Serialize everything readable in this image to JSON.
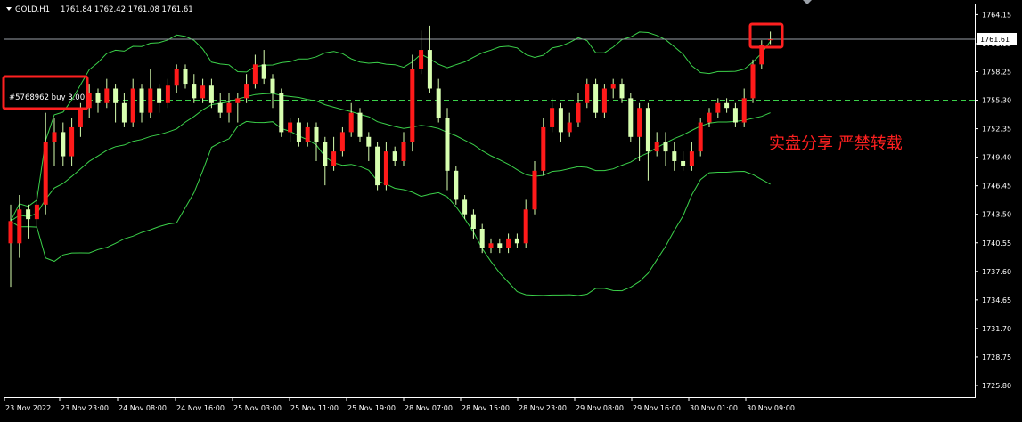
{
  "header": {
    "symbol": "GOLD,H1",
    "ohlc": "1761.84 1762.42 1761.08 1761.61"
  },
  "annotations": {
    "order_label": "#5768962 buy 3.00",
    "watermark": "实盘分享 严禁转载"
  },
  "colors": {
    "background": "#000000",
    "bull_candle": "#ff1a1a",
    "bear_candle": "#d8ffb0",
    "wick": "#d8ffb0",
    "bands": "#3bd14a",
    "order_line": "#3bd14a",
    "grid_axis": "#ffffff",
    "highlight_box": "#ff2020",
    "watermark": "#ff2020",
    "price_tag_bg": "#ffffff"
  },
  "chart_data": {
    "type": "candlestick",
    "timeframe": "H1",
    "y_axis": {
      "ylim": [
        1724.6,
        1765.2
      ],
      "ticks": [
        "1764.15",
        "1761.15",
        "1758.25",
        "1755.30",
        "1752.35",
        "1749.40",
        "1746.45",
        "1743.50",
        "1740.55",
        "1737.60",
        "1734.65",
        "1731.70",
        "1728.75",
        "1725.80"
      ],
      "current_price": "1761.61"
    },
    "x_axis": {
      "ticks": [
        "23 Nov 2022",
        "23 Nov 23:00",
        "24 Nov 08:00",
        "24 Nov 16:00",
        "25 Nov 03:00",
        "25 Nov 11:00",
        "25 Nov 19:00",
        "28 Nov 07:00",
        "28 Nov 15:00",
        "28 Nov 23:00",
        "29 Nov 08:00",
        "29 Nov 16:00",
        "30 Nov 01:00",
        "30 Nov 09:00"
      ]
    },
    "order_level": 1755.3,
    "candles": [
      [
        1740.5,
        1742.8,
        1736.0,
        1744.5
      ],
      [
        1740.5,
        1744.0,
        1739.0,
        1745.5
      ],
      [
        1744.0,
        1743.0,
        1741.0,
        1744.5
      ],
      [
        1743.0,
        1744.5,
        1742.0,
        1746.0
      ],
      [
        1744.5,
        1751.0,
        1743.5,
        1754.0
      ],
      [
        1751.0,
        1752.0,
        1748.5,
        1753.5
      ],
      [
        1752.0,
        1749.5,
        1748.5,
        1753.0
      ],
      [
        1749.5,
        1752.5,
        1748.5,
        1753.5
      ],
      [
        1752.5,
        1754.5,
        1751.5,
        1755.0
      ],
      [
        1754.5,
        1756.0,
        1753.5,
        1757.0
      ],
      [
        1756.0,
        1755.0,
        1754.0,
        1756.5
      ],
      [
        1755.0,
        1756.5,
        1754.5,
        1757.5
      ],
      [
        1756.5,
        1755.0,
        1753.0,
        1757.0
      ],
      [
        1755.0,
        1753.0,
        1752.5,
        1756.0
      ],
      [
        1753.0,
        1756.5,
        1752.5,
        1757.5
      ],
      [
        1756.5,
        1754.0,
        1753.0,
        1757.0
      ],
      [
        1754.0,
        1756.5,
        1753.5,
        1758.5
      ],
      [
        1756.5,
        1755.0,
        1754.0,
        1757.0
      ],
      [
        1755.0,
        1756.8,
        1754.5,
        1757.5
      ],
      [
        1756.8,
        1758.5,
        1756.0,
        1759.0
      ],
      [
        1758.5,
        1757.0,
        1756.5,
        1759.0
      ],
      [
        1757.0,
        1755.5,
        1755.0,
        1758.0
      ],
      [
        1755.5,
        1756.8,
        1755.0,
        1757.5
      ],
      [
        1756.8,
        1755.0,
        1754.5,
        1757.5
      ],
      [
        1755.0,
        1754.0,
        1753.5,
        1756.0
      ],
      [
        1754.0,
        1755.0,
        1753.0,
        1756.0
      ],
      [
        1755.0,
        1755.5,
        1753.0,
        1756.0
      ],
      [
        1755.5,
        1757.0,
        1755.0,
        1758.0
      ],
      [
        1757.0,
        1759.0,
        1756.5,
        1760.0
      ],
      [
        1759.0,
        1757.5,
        1757.0,
        1760.5
      ],
      [
        1757.5,
        1756.0,
        1754.5,
        1758.0
      ],
      [
        1756.0,
        1752.0,
        1751.5,
        1756.5
      ],
      [
        1752.0,
        1753.0,
        1751.0,
        1753.5
      ],
      [
        1753.0,
        1751.0,
        1750.5,
        1753.5
      ],
      [
        1751.0,
        1752.5,
        1750.5,
        1753.0
      ],
      [
        1752.5,
        1751.0,
        1749.0,
        1753.0
      ],
      [
        1751.0,
        1748.5,
        1746.5,
        1751.5
      ],
      [
        1748.5,
        1750.0,
        1748.0,
        1751.5
      ],
      [
        1750.0,
        1752.0,
        1749.5,
        1752.5
      ],
      [
        1752.0,
        1754.0,
        1751.5,
        1755.0
      ],
      [
        1754.0,
        1751.5,
        1751.0,
        1754.5
      ],
      [
        1751.5,
        1750.5,
        1749.0,
        1752.0
      ],
      [
        1750.5,
        1746.5,
        1746.0,
        1751.0
      ],
      [
        1746.5,
        1750.0,
        1746.0,
        1751.0
      ],
      [
        1750.0,
        1749.0,
        1748.5,
        1750.5
      ],
      [
        1749.0,
        1751.0,
        1748.5,
        1752.0
      ],
      [
        1751.0,
        1758.5,
        1750.0,
        1760.0
      ],
      [
        1758.5,
        1760.5,
        1758.0,
        1762.5
      ],
      [
        1760.5,
        1756.5,
        1756.0,
        1763.0
      ],
      [
        1756.5,
        1753.5,
        1753.0,
        1757.5
      ],
      [
        1753.5,
        1748.0,
        1746.0,
        1754.5
      ],
      [
        1748.0,
        1745.0,
        1744.5,
        1748.5
      ],
      [
        1745.0,
        1743.5,
        1743.0,
        1745.5
      ],
      [
        1743.5,
        1742.0,
        1741.0,
        1744.0
      ],
      [
        1742.0,
        1740.0,
        1739.5,
        1742.5
      ],
      [
        1740.0,
        1740.5,
        1739.5,
        1741.0
      ],
      [
        1740.5,
        1740.0,
        1739.5,
        1741.0
      ],
      [
        1740.0,
        1741.0,
        1739.5,
        1741.5
      ],
      [
        1741.0,
        1740.5,
        1740.0,
        1741.5
      ],
      [
        1740.5,
        1744.0,
        1740.0,
        1745.0
      ],
      [
        1744.0,
        1748.0,
        1743.5,
        1749.0
      ],
      [
        1748.0,
        1752.5,
        1747.5,
        1753.5
      ],
      [
        1752.5,
        1754.5,
        1752.0,
        1755.5
      ],
      [
        1754.5,
        1752.0,
        1751.0,
        1755.0
      ],
      [
        1752.0,
        1753.0,
        1751.5,
        1754.0
      ],
      [
        1753.0,
        1755.0,
        1752.5,
        1756.0
      ],
      [
        1755.0,
        1757.0,
        1754.5,
        1757.5
      ],
      [
        1757.0,
        1754.0,
        1753.5,
        1757.5
      ],
      [
        1754.0,
        1756.5,
        1753.5,
        1757.0
      ],
      [
        1756.5,
        1757.0,
        1755.5,
        1757.5
      ],
      [
        1757.0,
        1755.5,
        1755.0,
        1757.5
      ],
      [
        1755.5,
        1751.5,
        1751.0,
        1756.0
      ],
      [
        1751.5,
        1754.5,
        1749.0,
        1755.0
      ],
      [
        1754.5,
        1750.0,
        1747.0,
        1755.0
      ],
      [
        1750.0,
        1751.0,
        1749.5,
        1752.0
      ],
      [
        1751.0,
        1750.0,
        1748.5,
        1752.0
      ],
      [
        1750.0,
        1749.0,
        1748.0,
        1751.0
      ],
      [
        1749.0,
        1748.5,
        1748.0,
        1750.0
      ],
      [
        1748.5,
        1750.0,
        1748.0,
        1751.0
      ],
      [
        1750.0,
        1753.0,
        1749.5,
        1753.5
      ],
      [
        1753.0,
        1754.0,
        1752.5,
        1754.5
      ],
      [
        1754.0,
        1755.0,
        1753.5,
        1755.5
      ],
      [
        1755.0,
        1754.5,
        1754.0,
        1755.5
      ],
      [
        1754.5,
        1753.0,
        1752.5,
        1755.0
      ],
      [
        1753.0,
        1755.5,
        1752.5,
        1756.5
      ],
      [
        1755.5,
        1759.0,
        1755.0,
        1759.5
      ],
      [
        1759.0,
        1761.0,
        1758.5,
        1761.5
      ],
      [
        1761.5,
        1761.6,
        1761.1,
        1762.4
      ]
    ]
  }
}
